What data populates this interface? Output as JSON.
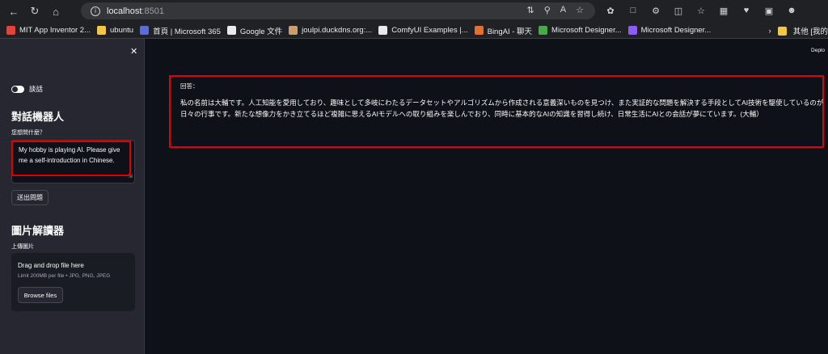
{
  "browser": {
    "address": {
      "host": "localhost",
      "port": ":8501"
    }
  },
  "bookmarks": [
    {
      "label": "MIT App Inventor 2...",
      "color": "#e0443c"
    },
    {
      "label": "ubuntu",
      "color": "#f2c744"
    },
    {
      "label": "首頁 | Microsoft 365",
      "color": "#5b6cd9"
    },
    {
      "label": "Google 文件",
      "color": "#e8eaed"
    },
    {
      "label": "joulpi.duckdns.org:...",
      "color": "#c8a070"
    },
    {
      "label": "ComfyUI Examples |...",
      "color": "#e8eaed"
    },
    {
      "label": "BingAI - 聊天",
      "color": "#e2702e"
    },
    {
      "label": "Microsoft Designer...",
      "color": "#4aa84a"
    },
    {
      "label": "Microsoft Designer...",
      "color": "#8b5cf6"
    }
  ],
  "bookmarks_more": "其他 [我的",
  "app": {
    "deploy": "Deplo",
    "sidebar": {
      "toggle_label": "談話",
      "chat_title": "對話機器人",
      "question_label": "您想問什麼？",
      "question_value": "My hobby is playing AI. Please give me a self-introduction in Chinese.",
      "send_button": "送出問題",
      "image_title": "圖片解讀器",
      "upload_label": "上傳圖片",
      "dropzone_title": "Drag and drop file here",
      "dropzone_limits": "Limit 200MB per file • JPG, PNG, JPEG",
      "browse_button": "Browse files"
    },
    "main": {
      "answer_label": "回答：",
      "answer_text": "私の名前は大輔です。人工知能を愛用しており、趣味として多岐にわたるデータセットやアルゴリズムから作成される意義深いものを見つけ、また実証的な問題を解決する手段としてAI技術を駆使しているのが日々の行事です。新たな想像力をかき立てるほど複雑に思えるAIモデルへの取り組みを楽しんでおり、同時に基本的なAIの知識を習得し続け、日常生活にAIとの会話が夢にています。(大輔）"
    }
  },
  "colors": {
    "highlight": "#e00000",
    "bg": "#0e1117",
    "sidebar": "#262730"
  }
}
